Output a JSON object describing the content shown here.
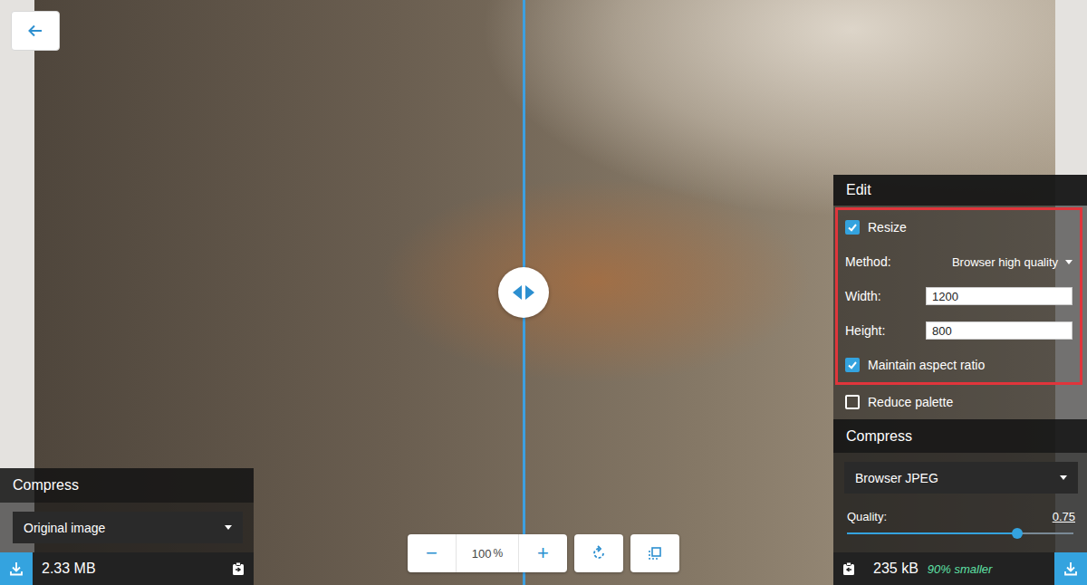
{
  "divider": {
    "level": 0.482
  },
  "left_panel": {
    "title": "Compress",
    "method": "Original image",
    "size": "2.33 MB"
  },
  "toolbar": {
    "zoom_out": "−",
    "zoom_value": "100",
    "zoom_unit": "%",
    "zoom_in": "+"
  },
  "edit": {
    "title": "Edit",
    "highlight": {
      "highlighted": true,
      "rows": [
        {
          "kind": "checkbox",
          "label": "Resize",
          "checked": true
        },
        {
          "kind": "select",
          "label": "Method:",
          "value": "Browser high quality"
        },
        {
          "kind": "input",
          "label": "Width:",
          "value": "1200"
        },
        {
          "kind": "input",
          "label": "Height:",
          "value": "800"
        },
        {
          "kind": "checkbox",
          "label": "Maintain aspect ratio",
          "checked": true
        }
      ]
    },
    "rows": [
      {
        "kind": "checkbox",
        "label": "Reduce palette",
        "checked": false
      }
    ]
  },
  "compress": {
    "title": "Compress",
    "method": "Browser JPEG",
    "quality": {
      "label": "Quality:",
      "reading": "0.75",
      "level": 0.75
    },
    "size": "235 kB",
    "savings": "90% smaller"
  }
}
